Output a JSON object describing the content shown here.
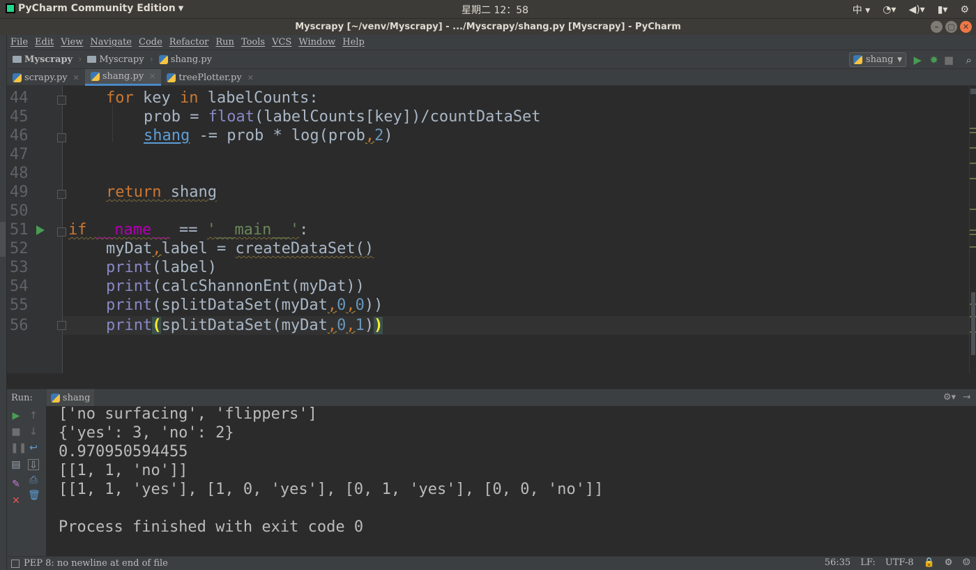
{
  "system": {
    "app_name": "PyCharm Community Edition",
    "clock": "星期二 12：58",
    "input_method": "中"
  },
  "window": {
    "title": "Myscrapy [~/venv/Myscrapy] - .../Myscrapy/shang.py [Myscrapy] - PyCharm"
  },
  "menu": [
    "File",
    "Edit",
    "View",
    "Navigate",
    "Code",
    "Refactor",
    "Run",
    "Tools",
    "VCS",
    "Window",
    "Help"
  ],
  "breadcrumb": [
    "Myscrapy",
    "Myscrapy",
    "shang.py"
  ],
  "run_config": {
    "label": "shang"
  },
  "tabs": [
    {
      "label": "scrapy.py",
      "active": false
    },
    {
      "label": "shang.py",
      "active": true
    },
    {
      "label": "treePlotter.py",
      "active": false
    }
  ],
  "editor": {
    "line_numbers": [
      "44",
      "45",
      "46",
      "47",
      "48",
      "49",
      "50",
      "51",
      "52",
      "53",
      "54",
      "55",
      "56"
    ],
    "code_text": {
      "l44_kw1": "for",
      "l44_mid": " key ",
      "l44_kw2": "in",
      "l44_rest": " labelCounts:",
      "l45_a": "prob = ",
      "l45_bi": "float",
      "l45_b": "(labelCounts[key])/countDataSet",
      "l46_var": "shang",
      "l46_a": " -= prob * log(prob",
      "l46_comma": ",",
      "l46_num": "2",
      "l46_b": ")",
      "l49_kw": "return",
      "l49_var": "shang",
      "l51_kw": "if",
      "l51_name": "__name__",
      "l51_eq": " == ",
      "l51_str": "'__main__'",
      "l51_colon": ":",
      "l52_a": "myDat",
      "l52_comma": ",",
      "l52_b": "label = ",
      "l52_c": "createDataSet()",
      "l53_bi": "print",
      "l53_a": "(label)",
      "l54_bi": "print",
      "l54_a": "(calcShannonEnt(myDat))",
      "l55_bi": "print",
      "l55_a": "(splitDataSet(myDat",
      "l55_c1": ",",
      "l55_n1": "0",
      "l55_c2": ",",
      "l55_n2": "0",
      "l55_b": "))",
      "l56_bi": "print",
      "l56_p1": "(",
      "l56_a": "splitDataSet(myDat",
      "l56_c1": ",",
      "l56_n1": "0",
      "l56_c2": ",",
      "l56_n2": "1",
      "l56_b": ")",
      "l56_p2": ")"
    }
  },
  "run_panel": {
    "label": "Run:",
    "tab": "shang",
    "output": [
      "['no surfacing', 'flippers']",
      "{'yes': 3, 'no': 2}",
      "0.970950594455",
      "[[1, 1, 'no']]",
      "[[1, 1, 'yes'], [1, 0, 'yes'], [0, 1, 'yes'], [0, 0, 'no']]",
      "",
      "Process finished with exit code 0"
    ]
  },
  "status": {
    "message": "PEP 8: no newline at end of file",
    "position": "56:35",
    "line_sep": "LF:",
    "encoding": "UTF-8"
  },
  "colors": {
    "background": "#2b2b2b",
    "keyword": "#cc7832",
    "builtin": "#8888c6",
    "number": "#6897bb",
    "string": "#6a8759",
    "run_green": "#499c54"
  }
}
